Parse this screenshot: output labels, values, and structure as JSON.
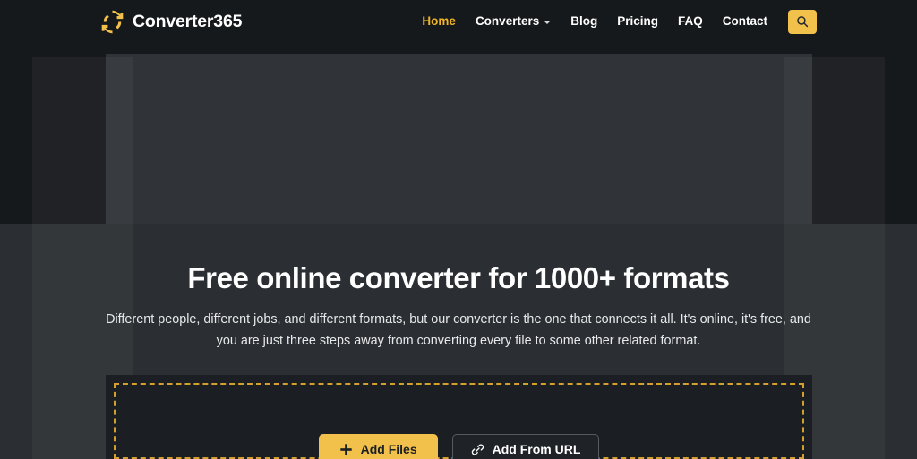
{
  "brand": {
    "name": "Converter365",
    "icon": "refresh-sync-icon"
  },
  "colors": {
    "accent": "#f2c14b",
    "accent_text": "#f0b429",
    "dashed_border": "#d3a02e",
    "page_background": "#16191c",
    "hero_panel": "#303438",
    "lower_band": "#2b2e32",
    "dropzone_background": "#1b1e22",
    "text_primary": "#ffffff"
  },
  "nav": {
    "items": [
      {
        "label": "Home",
        "active": true,
        "has_dropdown": false
      },
      {
        "label": "Converters",
        "active": false,
        "has_dropdown": true
      },
      {
        "label": "Blog",
        "active": false,
        "has_dropdown": false
      },
      {
        "label": "Pricing",
        "active": false,
        "has_dropdown": false
      },
      {
        "label": "FAQ",
        "active": false,
        "has_dropdown": false
      },
      {
        "label": "Contact",
        "active": false,
        "has_dropdown": false
      }
    ],
    "search_icon": "search-icon"
  },
  "hero": {
    "title": "Free online converter for 1000+ formats",
    "subtitle": "Different people, different jobs, and different formats, but our converter is the one that connects it all. It's online, it's free, and you are just three steps away from converting every file to some other related format."
  },
  "dropzone": {
    "add_files_label": "Add Files",
    "add_files_icon": "plus-icon",
    "add_from_url_label": "Add From URL",
    "add_from_url_icon": "link-icon"
  }
}
